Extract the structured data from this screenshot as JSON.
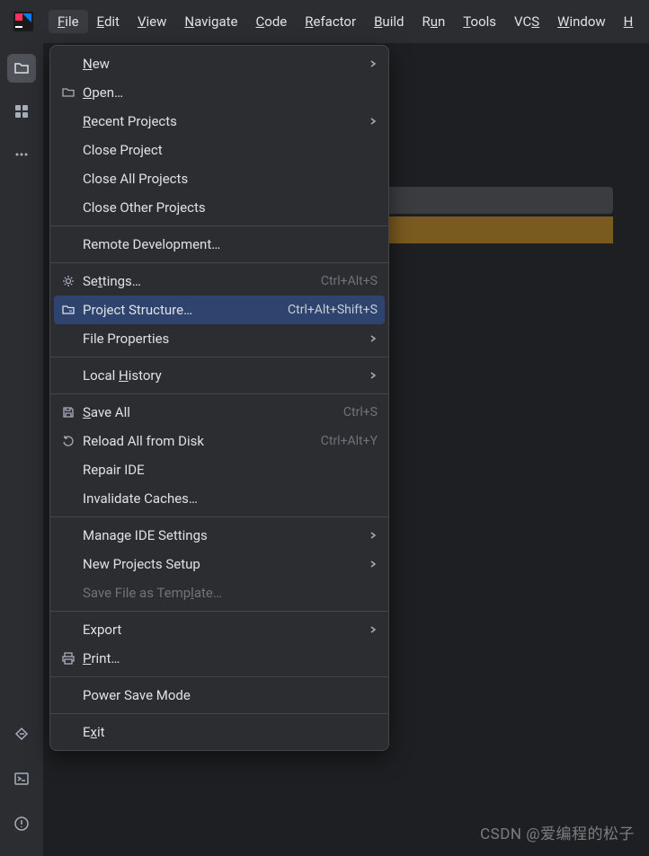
{
  "menubar": {
    "items": [
      {
        "label": "File",
        "mnemonic": "F",
        "active": true
      },
      {
        "label": "Edit",
        "mnemonic": "E"
      },
      {
        "label": "View",
        "mnemonic": "V"
      },
      {
        "label": "Navigate",
        "mnemonic": "N"
      },
      {
        "label": "Code",
        "mnemonic": "C"
      },
      {
        "label": "Refactor",
        "mnemonic": "R"
      },
      {
        "label": "Build",
        "mnemonic": "B"
      },
      {
        "label": "Run",
        "mnemonic": "u",
        "prefix": "R"
      },
      {
        "label": "Tools",
        "mnemonic": "T"
      },
      {
        "label": "VCS",
        "mnemonic": "S",
        "prefix": "VC"
      },
      {
        "label": "Window",
        "mnemonic": "W"
      },
      {
        "label": "H",
        "mnemonic": "H"
      }
    ]
  },
  "dropdown": {
    "groups": [
      [
        {
          "label": "New",
          "mnemonic": "N",
          "icon": null,
          "submenu": true
        },
        {
          "label": "Open…",
          "mnemonic": "O",
          "icon": "folder"
        },
        {
          "label": "Recent Projects",
          "mnemonic": "R",
          "submenu": true
        },
        {
          "label": "Close Project"
        },
        {
          "label": "Close All Projects"
        },
        {
          "label": "Close Other Projects"
        }
      ],
      [
        {
          "label": "Remote Development…"
        }
      ],
      [
        {
          "label": "Settings…",
          "mnemonic": "t",
          "prefix": "Se",
          "icon": "gear",
          "shortcut": "Ctrl+Alt+S"
        },
        {
          "label": "Project Structure…",
          "icon": "project-structure",
          "shortcut": "Ctrl+Alt+Shift+S",
          "highlighted": true
        },
        {
          "label": "File Properties",
          "submenu": true
        }
      ],
      [
        {
          "label": "Local History",
          "mnemonic": "H",
          "prefix": "Local ",
          "submenu": true
        }
      ],
      [
        {
          "label": "Save All",
          "mnemonic": "S",
          "icon": "save",
          "shortcut": "Ctrl+S"
        },
        {
          "label": "Reload All from Disk",
          "icon": "reload",
          "shortcut": "Ctrl+Alt+Y"
        },
        {
          "label": "Repair IDE"
        },
        {
          "label": "Invalidate Caches…"
        }
      ],
      [
        {
          "label": "Manage IDE Settings",
          "submenu": true
        },
        {
          "label": "New Projects Setup",
          "submenu": true
        },
        {
          "label": "Save File as Template…",
          "mnemonic": "l",
          "prefix": "Save File as Temp",
          "disabled": true
        }
      ],
      [
        {
          "label": "Export",
          "submenu": true
        },
        {
          "label": "Print…",
          "mnemonic": "P",
          "icon": "print"
        }
      ],
      [
        {
          "label": "Power Save Mode"
        }
      ],
      [
        {
          "label": "Exit",
          "mnemonic": "x",
          "prefix": "E"
        }
      ]
    ]
  },
  "watermark": "CSDN @爱编程的松子"
}
